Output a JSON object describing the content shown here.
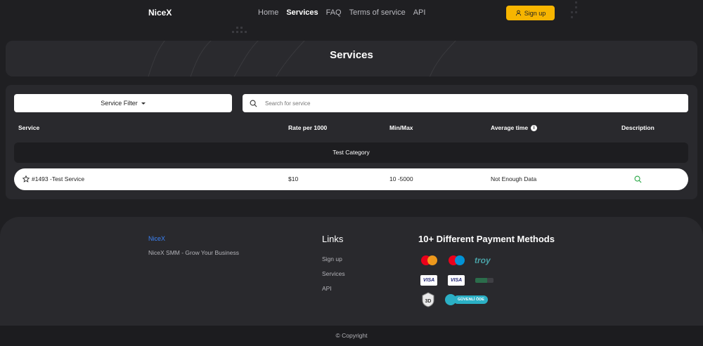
{
  "header": {
    "brand": "NiceX",
    "nav": [
      {
        "label": "Home",
        "active": false
      },
      {
        "label": "Services",
        "active": true
      },
      {
        "label": "FAQ",
        "active": false
      },
      {
        "label": "Terms of service",
        "active": false
      },
      {
        "label": "API",
        "active": false
      }
    ],
    "signup_label": "Sign up",
    "accent_color": "#f7b500"
  },
  "hero": {
    "title": "Services"
  },
  "filters": {
    "service_filter_label": "Service Filter",
    "search_placeholder": "Search for service"
  },
  "table": {
    "headers": {
      "service": "Service",
      "rate": "Rate per 1000",
      "minmax": "Min/Max",
      "avg_time": "Average time",
      "description": "Description"
    },
    "category": "Test Category",
    "rows": [
      {
        "service": "#1493 -Test Service",
        "rate": "$10",
        "minmax": "10 -5000",
        "avg_time": "Not Enough Data",
        "description_icon": "search-icon"
      }
    ]
  },
  "footer": {
    "brand": "NiceX",
    "tagline": "NiceX SMM  - Grow Your Business",
    "links_title": "Links",
    "links": [
      "Sign up",
      "Services",
      "API"
    ],
    "payments_title": "10+ Different Payment Methods",
    "payment_methods": [
      "mastercard",
      "maestro",
      "troy",
      "visa",
      "visa",
      "paycell",
      "3d-secure",
      "go-guvenli-ode"
    ],
    "payment_labels": {
      "troy": "troy",
      "visa": "VISA",
      "go": "GÜVENLİ ÖDE",
      "three_d": "3D"
    },
    "copyright": "© Copyright"
  }
}
